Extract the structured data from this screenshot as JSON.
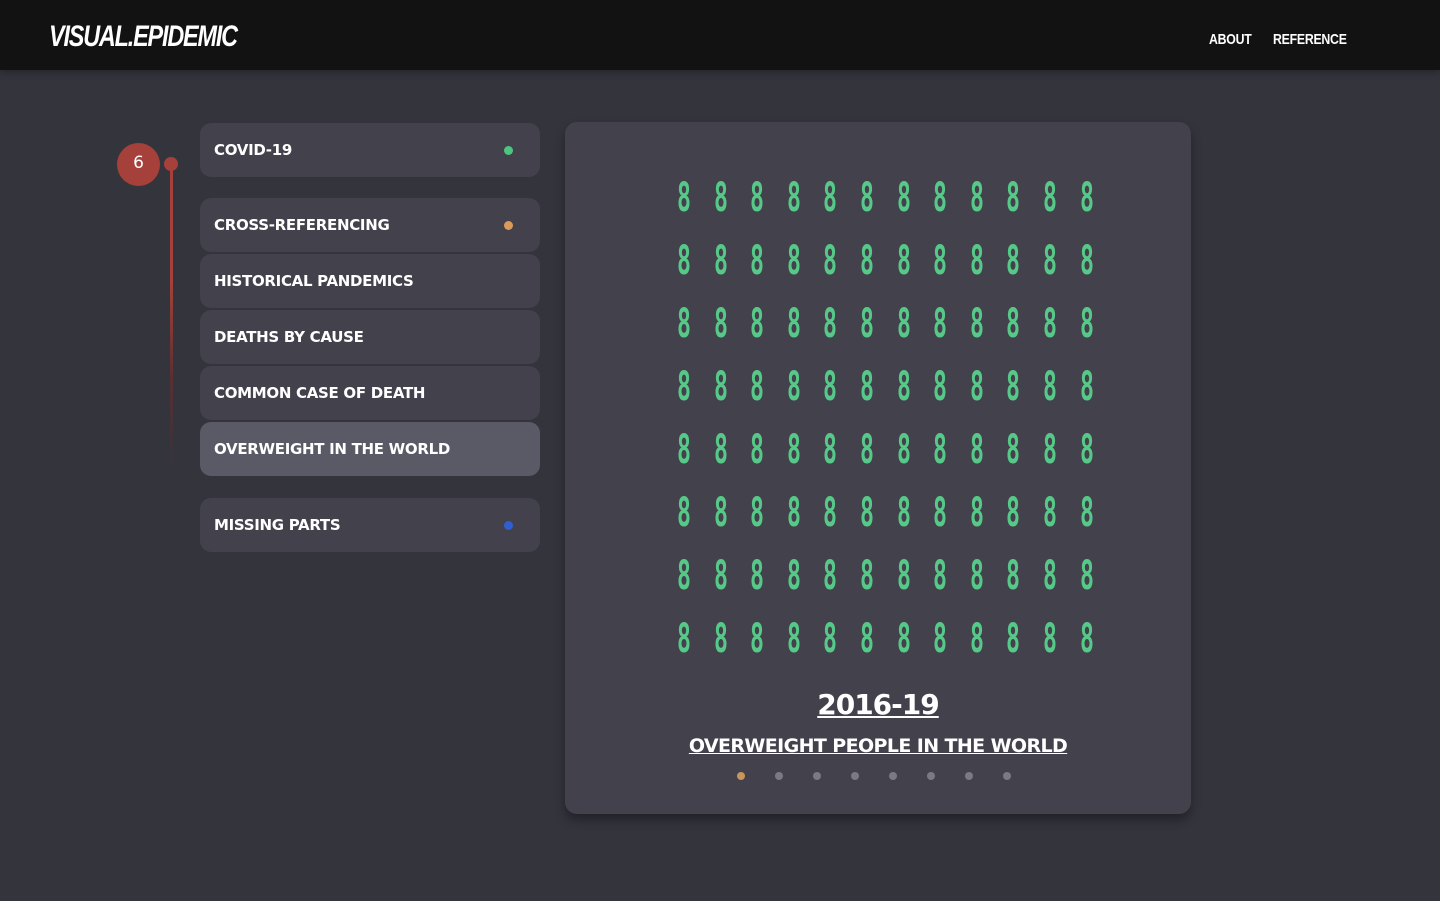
{
  "header": {
    "logo": "VISUAL.EPIDEMIC",
    "nav": [
      {
        "label": "ABOUT"
      },
      {
        "label": "REFERENCE"
      }
    ]
  },
  "stepper": {
    "current": "6",
    "accent": "#a5413a"
  },
  "menu": {
    "items": [
      {
        "label": "COVID-19",
        "dot_color": "#4cc67f"
      },
      {
        "label": "CROSS-REFERENCING",
        "dot_color": "#d99a5b"
      },
      {
        "label": "HISTORICAL PANDEMICS"
      },
      {
        "label": "DEATHS BY CAUSE"
      },
      {
        "label": "COMMON CASE OF DEATH"
      },
      {
        "label": "OVERWEIGHT IN THE WORLD",
        "active": true
      },
      {
        "label": "MISSING PARTS",
        "dot_color": "#2f5fd0"
      }
    ]
  },
  "card": {
    "icon": "person-icon",
    "icon_color": "#56c888",
    "icon_rows": 8,
    "icon_cols": 12,
    "year": "2016-19",
    "caption": "OVERWEIGHT PEOPLE IN THE WORLD",
    "pager": {
      "pages": 8,
      "active_index": 0,
      "active_color": "#c8965a",
      "inactive_color": "#7a7a84"
    }
  }
}
